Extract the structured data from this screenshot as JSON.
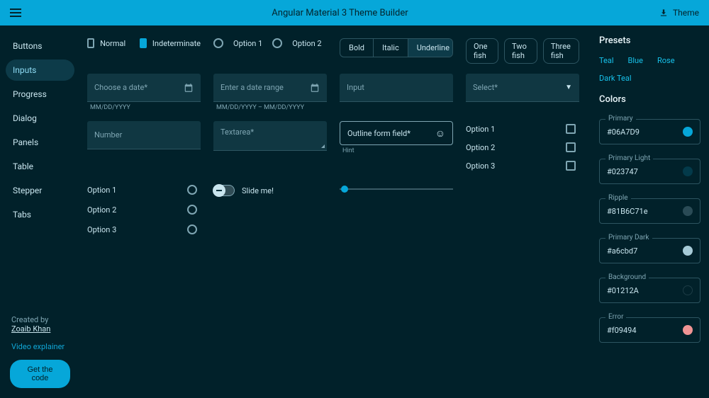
{
  "topbar": {
    "title": "Angular Material 3 Theme Builder",
    "theme_label": "Theme"
  },
  "sidebar": {
    "items": [
      {
        "label": "Buttons"
      },
      {
        "label": "Inputs"
      },
      {
        "label": "Progress"
      },
      {
        "label": "Dialog"
      },
      {
        "label": "Panels"
      },
      {
        "label": "Table"
      },
      {
        "label": "Stepper"
      },
      {
        "label": "Tabs"
      }
    ],
    "active_index": 1,
    "credit_prefix": "Created by ",
    "credit_author": "Zoaib Khan",
    "video_link": "Video explainer",
    "get_code": "Get the code"
  },
  "main": {
    "cb_normal": "Normal",
    "cb_ind": "Indeterminate",
    "radio_a": "Option 1",
    "radio_b": "Option 2",
    "seg_bold": "Bold",
    "seg_italic": "Italic",
    "seg_underline": "Underline",
    "chip1": "One fish",
    "chip2": "Two fish",
    "chip3": "Three fish",
    "date_label": "Choose a date*",
    "date_hint": "MM/DD/YYYY",
    "range_label": "Enter a date range",
    "range_hint": "MM/DD/YYYY – MM/DD/YYYY",
    "input_label": "Input",
    "select_label": "Select*",
    "number_label": "Number",
    "textarea_label": "Textarea*",
    "outline_label": "Outline form field*",
    "outline_hint": "Hint",
    "check_opts": [
      "Option 1",
      "Option 2",
      "Option 3"
    ],
    "radio_opts": [
      "Option 1",
      "Option 2",
      "Option 3"
    ],
    "slide_label": "Slide me!"
  },
  "right": {
    "presets_h": "Presets",
    "presets": [
      "Teal",
      "Blue",
      "Rose"
    ],
    "preset_extra": "Dark Teal",
    "colors_h": "Colors",
    "colors": [
      {
        "label": "Primary",
        "value": "#06A7D9",
        "swatch": "#06A7D9"
      },
      {
        "label": "Primary Light",
        "value": "#023747",
        "swatch": "#033a4a"
      },
      {
        "label": "Ripple",
        "value": "#81B6C71e",
        "swatch": "#2a4b56"
      },
      {
        "label": "Primary Dark",
        "value": "#a6cbd7",
        "swatch": "#a6cbd7"
      },
      {
        "label": "Background",
        "value": "#01212A",
        "swatch": "#01212A"
      },
      {
        "label": "Error",
        "value": "#f09494",
        "swatch": "#f09494"
      }
    ]
  }
}
